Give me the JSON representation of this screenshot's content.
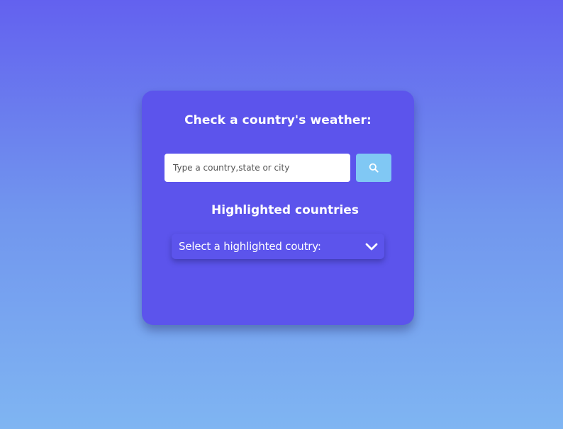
{
  "card": {
    "title": "Check a country's weather:",
    "search": {
      "placeholder": "Type a country,state or city",
      "value": "",
      "button_icon": "search-icon"
    },
    "highlighted": {
      "title": "Highlighted countries",
      "select_label": "Select a highlighted coutry:",
      "dropdown_icon": "chevron-down-icon"
    }
  },
  "colors": {
    "background_top": "#6361ef",
    "background_bottom": "#7fb5f2",
    "card": "#5c54ec",
    "search_button": "#80c8f4",
    "text": "#ffffff"
  }
}
